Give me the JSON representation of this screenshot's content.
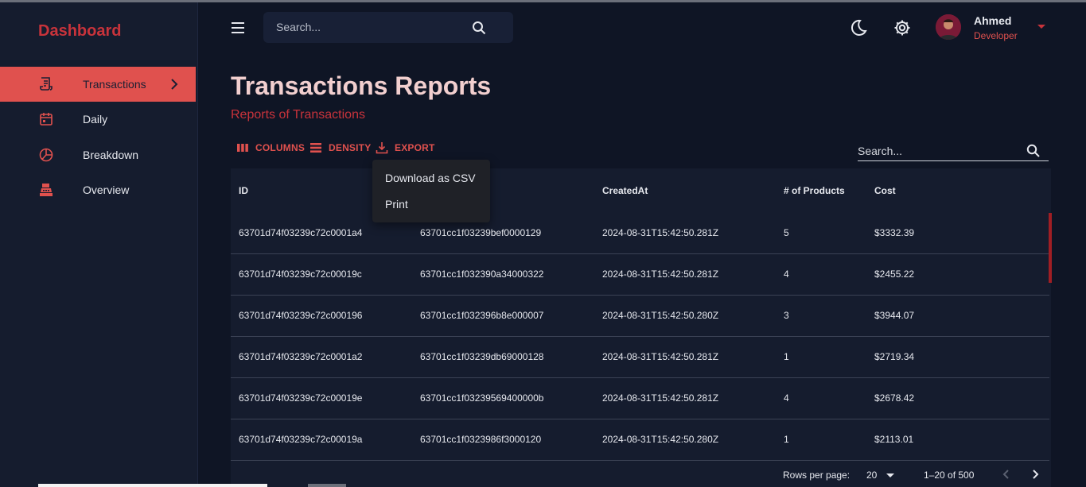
{
  "sidebar": {
    "brand": "Dashboard",
    "items": [
      {
        "label": "Transactions",
        "icon": "receipt-icon",
        "active": true
      },
      {
        "label": "Daily",
        "icon": "calendar-icon",
        "active": false
      },
      {
        "label": "Breakdown",
        "icon": "pie-chart-icon",
        "active": false
      },
      {
        "label": "Overview",
        "icon": "cash-register-icon",
        "active": false
      }
    ]
  },
  "header": {
    "search_placeholder": "Search...",
    "user": {
      "name": "Ahmed",
      "role": "Developer"
    }
  },
  "page": {
    "title": "Transactions Reports",
    "subtitle": "Reports of Transactions"
  },
  "toolbar": {
    "columns_label": "COLUMNS",
    "density_label": "DENSITY",
    "export_label": "EXPORT",
    "search_placeholder": "Search..."
  },
  "export_menu": {
    "items": [
      "Download as CSV",
      "Print"
    ]
  },
  "table": {
    "columns": [
      "ID",
      "",
      "CreatedAt",
      "# of Products",
      "Cost"
    ],
    "rows": [
      [
        "63701d74f03239c72c0001a4",
        "63701cc1f03239bef0000129",
        "2024-08-31T15:42:50.281Z",
        "5",
        "$3332.39"
      ],
      [
        "63701d74f03239c72c00019c",
        "63701cc1f032390a34000322",
        "2024-08-31T15:42:50.281Z",
        "4",
        "$2455.22"
      ],
      [
        "63701d74f03239c72c000196",
        "63701cc1f032396b8e000007",
        "2024-08-31T15:42:50.280Z",
        "3",
        "$3944.07"
      ],
      [
        "63701d74f03239c72c0001a2",
        "63701cc1f03239db69000128",
        "2024-08-31T15:42:50.281Z",
        "1",
        "$2719.34"
      ],
      [
        "63701d74f03239c72c00019e",
        "63701cc1f03239569400000b",
        "2024-08-31T15:42:50.281Z",
        "4",
        "$2678.42"
      ],
      [
        "63701d74f03239c72c00019a",
        "63701cc1f0323986f3000120",
        "2024-08-31T15:42:50.280Z",
        "1",
        "$2113.01"
      ]
    ]
  },
  "pagination": {
    "rows_per_page_label": "Rows per page:",
    "rows_per_page_value": "20",
    "range": "1–20 of 500"
  },
  "colors": {
    "accent": "#e0514e",
    "brand": "#c8333b",
    "background": "#0f1525",
    "panel": "#151c2e"
  }
}
